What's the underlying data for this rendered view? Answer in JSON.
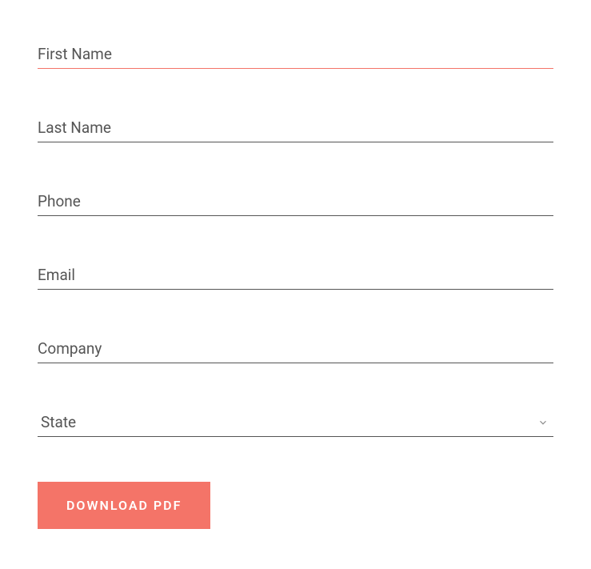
{
  "form": {
    "fields": {
      "first_name": {
        "placeholder": "First Name",
        "value": ""
      },
      "last_name": {
        "placeholder": "Last Name",
        "value": ""
      },
      "phone": {
        "placeholder": "Phone",
        "value": ""
      },
      "email": {
        "placeholder": "Email",
        "value": ""
      },
      "company": {
        "placeholder": "Company",
        "value": ""
      },
      "state": {
        "label": "State",
        "selected": ""
      }
    },
    "submit_label": "DOWNLOAD PDF"
  },
  "colors": {
    "accent": "#f47468",
    "underline": "#555555",
    "text": "#555555"
  }
}
